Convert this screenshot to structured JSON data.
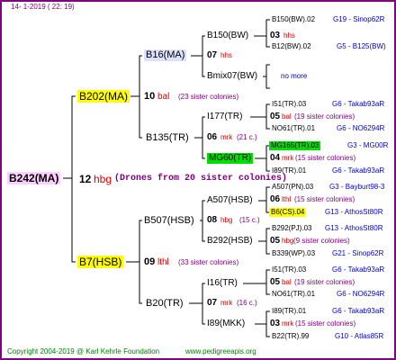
{
  "header": {
    "date": "14-   1-2019  ( 22: 19)"
  },
  "footer": {
    "copyright": "Copyright 2004-2019 @ Karl Kehrle Foundation",
    "site": "www.pedigreeapis.org"
  },
  "gen1": {
    "name": "B242(MA)",
    "num": "12",
    "code": "hbg",
    "note": "(Drones from 20 sister colonies)"
  },
  "gen2": [
    {
      "name": "B202(MA)",
      "num": "10",
      "code": "bal",
      "note": "(23 sister colonies)"
    },
    {
      "name": "B7(HSB)",
      "num": "09",
      "code": "lthl",
      "note": "(33 sister colonies)"
    }
  ],
  "gen3": [
    {
      "name": "B16(MA)",
      "num": "07",
      "code": "hhs",
      "note": ""
    },
    {
      "name": "B135(TR)",
      "num": "06",
      "code": "mrk",
      "note": "(21 c.)"
    },
    {
      "name": "B507(HSB)",
      "num": "08",
      "code": "hbg",
      "note": "(15 c.)"
    },
    {
      "name": "B20(TR)",
      "num": "07",
      "code": "mrk",
      "note": "(16 c.)"
    }
  ],
  "gen4": [
    {
      "name": "B150(BW)",
      "num": "03",
      "code": "hhs",
      "note": ""
    },
    {
      "name": "Bmix07(BW)",
      "note": "no more"
    },
    {
      "name": "I177(TR)",
      "num": "05",
      "code": "bal",
      "note": "(19 sister colonies)"
    },
    {
      "name": "MG60(TR)",
      "num": "04",
      "code": "mrk",
      "note": "(15 sister colonies)"
    },
    {
      "name": "A507(HSB)",
      "num": "06",
      "code": "lthl",
      "note": "(15 sister colonies)"
    },
    {
      "name": "B292(HSB)",
      "num": "05",
      "code": "hbg",
      "note": "(9 sister colonies)"
    },
    {
      "name": "I16(TR)",
      "num": "05",
      "code": "bal",
      "note": "(19 sister colonies)"
    },
    {
      "name": "I89(MKK)",
      "num": "03",
      "code": "mrk",
      "note": "(15 sister colonies)"
    }
  ],
  "gen5": [
    {
      "name": "B150(BW).02",
      "ref": "G19 - Sinop62R"
    },
    {
      "name": "B12(BW).02",
      "ref": "G5 - B125(BW)"
    },
    {
      "name": "I51(TR).03",
      "ref": "G6 - Takab93aR"
    },
    {
      "name": "NO61(TR).01",
      "ref": "G6 - NO6294R"
    },
    {
      "name": "MG165(TR).03",
      "ref": "G3 - MG00R"
    },
    {
      "name": "I89(TR).01",
      "ref": "G6 - Takab93aR"
    },
    {
      "name": "A507(PN).03",
      "ref": "G3 - Bayburt98-3"
    },
    {
      "name": "B6(CS).04",
      "ref": "G13 - AthosSt80R"
    },
    {
      "name": "B292(PJ).03",
      "ref": "G13 - AthosSt80R"
    },
    {
      "name": "B339(WP).03",
      "ref": "G21 - Sinop62R"
    },
    {
      "name": "I51(TR).03",
      "ref": "G6 - Takab93aR"
    },
    {
      "name": "NO61(TR).01",
      "ref": "G6 - NO6294R"
    },
    {
      "name": "I89(TR).01",
      "ref": "G6 - Takab93aR"
    },
    {
      "name": "B22(TR).99",
      "ref": "G10 - Atlas85R"
    }
  ],
  "colors": {
    "border": "#800080",
    "lines": "#000000",
    "highlight_pink": "#ffd0ff",
    "highlight_yellow": "#ffff00",
    "highlight_green": "#00dd00",
    "red": "#dd0000",
    "blue": "#0000cc",
    "purple": "#800080",
    "footer_green": "#008000"
  }
}
